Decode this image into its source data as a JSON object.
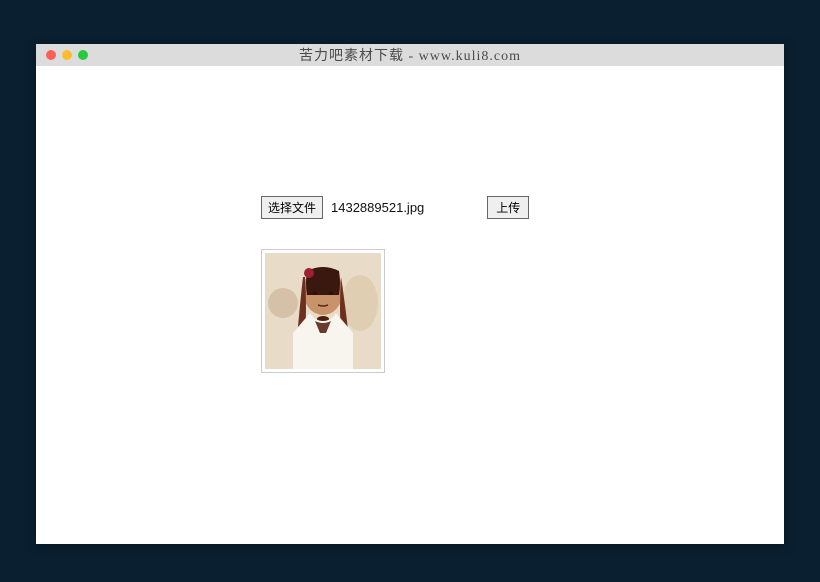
{
  "titlebar": {
    "title": "苦力吧素材下载 - www.kuli8.com"
  },
  "upload": {
    "choose_label": "选择文件",
    "filename": "1432889521.jpg",
    "upload_label": "上传"
  }
}
